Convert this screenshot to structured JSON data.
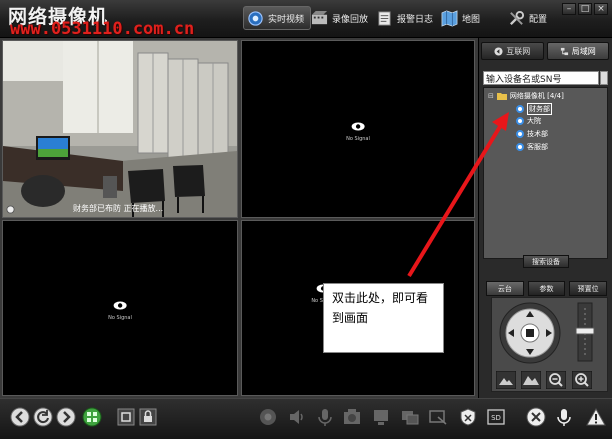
{
  "app": {
    "title": "网络摄像机",
    "watermark": "www.0531110.com.cn"
  },
  "nav": [
    {
      "label": "实时视频",
      "icon": "live-video-icon",
      "active": true
    },
    {
      "label": "录像回放",
      "icon": "playback-icon",
      "active": false
    },
    {
      "label": "报警日志",
      "icon": "alarm-log-icon",
      "active": false
    },
    {
      "label": "地图",
      "icon": "map-icon",
      "active": false
    },
    {
      "label": "配置",
      "icon": "config-icon",
      "active": false
    }
  ],
  "grid": {
    "no_signal": "No Signal",
    "cam1_caption": "财务部已布防  正在播放..."
  },
  "annotation": {
    "text": "双击此处，即可看到画面"
  },
  "right_panel": {
    "net_tabs": [
      {
        "label": "互联网",
        "active": false
      },
      {
        "label": "局域网",
        "active": true
      }
    ],
    "search_value": "输入设备名或SN号",
    "tree": {
      "root": "网络摄像机 [4/4]",
      "children": [
        "财务部",
        "大院",
        "技术部",
        "客服部"
      ],
      "selected": "财务部"
    },
    "search_button": "搜索设备",
    "ptz_tabs": [
      {
        "label": "云台",
        "active": true
      },
      {
        "label": "参数",
        "active": false
      },
      {
        "label": "预置位",
        "active": false
      }
    ]
  },
  "colors": {
    "accent": "#3a8ee6",
    "watermark": "#e0201c",
    "annotation_arrow": "#e8161a"
  }
}
